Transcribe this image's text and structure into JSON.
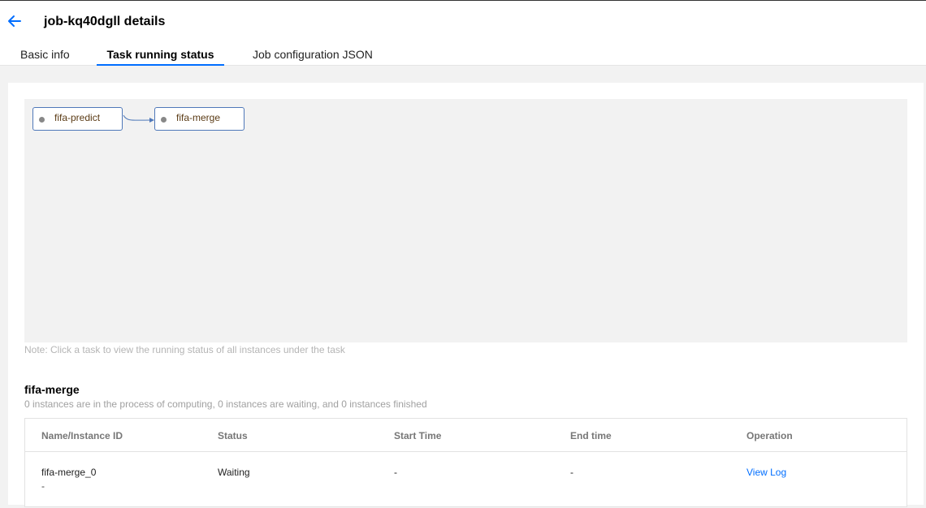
{
  "header": {
    "title": "job-kq40dgll details",
    "back_icon": "arrow-left-icon",
    "accent_color": "#006eff"
  },
  "tabs": [
    {
      "label": "Basic info",
      "active": false
    },
    {
      "label": "Task running status",
      "active": true
    },
    {
      "label": "Job configuration JSON",
      "active": false
    }
  ],
  "dag": {
    "nodes": [
      {
        "label": "fifa-predict"
      },
      {
        "label": "fifa-merge"
      }
    ],
    "edges": [
      {
        "from": "fifa-predict",
        "to": "fifa-merge"
      }
    ]
  },
  "note": "Note: Click a task to view the running status of all instances under the task",
  "task_detail": {
    "title": "fifa-merge",
    "summary": "0 instances are in the process of computing, 0 instances are waiting, and 0 instances finished",
    "table": {
      "columns": [
        "Name/Instance ID",
        "Status",
        "Start Time",
        "End time",
        "Operation"
      ],
      "rows": [
        {
          "name": "fifa-merge_0",
          "instance_id": "-",
          "status": "Waiting",
          "start_time": "-",
          "end_time": "-",
          "operation": "View Log"
        }
      ]
    }
  }
}
